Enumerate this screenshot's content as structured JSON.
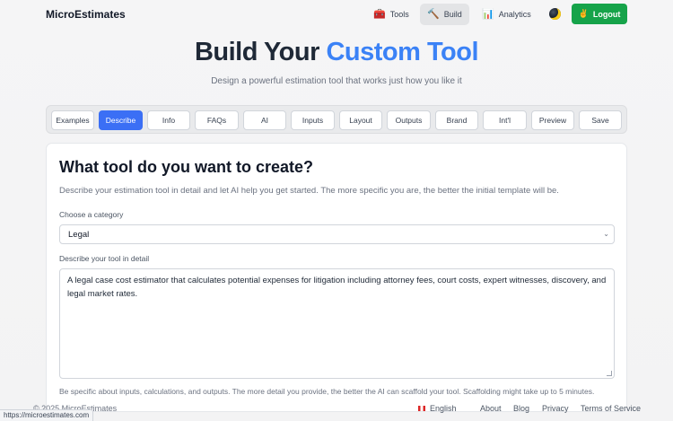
{
  "header": {
    "brand": "MicroEstimates",
    "nav": {
      "tools": "Tools",
      "build": "Build",
      "analytics": "Analytics"
    },
    "logout": "Logout"
  },
  "hero": {
    "title_main": "Build Your ",
    "title_accent": "Custom Tool",
    "subtitle": "Design a powerful estimation tool that works just how you like it"
  },
  "tabs": [
    "Examples",
    "Describe",
    "Info",
    "FAQs",
    "AI",
    "Inputs",
    "Layout",
    "Outputs",
    "Brand",
    "Int'l",
    "Preview",
    "Save"
  ],
  "active_tab": "Describe",
  "card": {
    "heading": "What tool do you want to create?",
    "description": "Describe your estimation tool in detail and let AI help you get started. The more specific you are, the better the initial template will be.",
    "category_label": "Choose a category",
    "category_value": "Legal",
    "detail_label": "Describe your tool in detail",
    "detail_value": "A legal case cost estimator that calculates potential expenses for litigation including attorney fees, court costs, expert witnesses, discovery, and legal market rates.",
    "hint": "Be specific about inputs, calculations, and outputs. The more detail you provide, the better the AI can scaffold your tool. Scaffolding might take up to 5 minutes."
  },
  "footer": {
    "copyright": "© 2025 MicroEstimates",
    "language": "English",
    "links": [
      "About",
      "Blog",
      "Privacy",
      "Terms of Service"
    ]
  },
  "status_url": "https://microestimates.com",
  "colors": {
    "accent": "#3b82f6",
    "active_tab": "#3b6ff5",
    "logout": "#16a34a"
  },
  "icons": {
    "tools": "toolbox-icon",
    "build": "hammer-icon",
    "analytics": "bar-chart-icon",
    "theme": "moon-icon",
    "logout": "victory-hand-icon"
  }
}
